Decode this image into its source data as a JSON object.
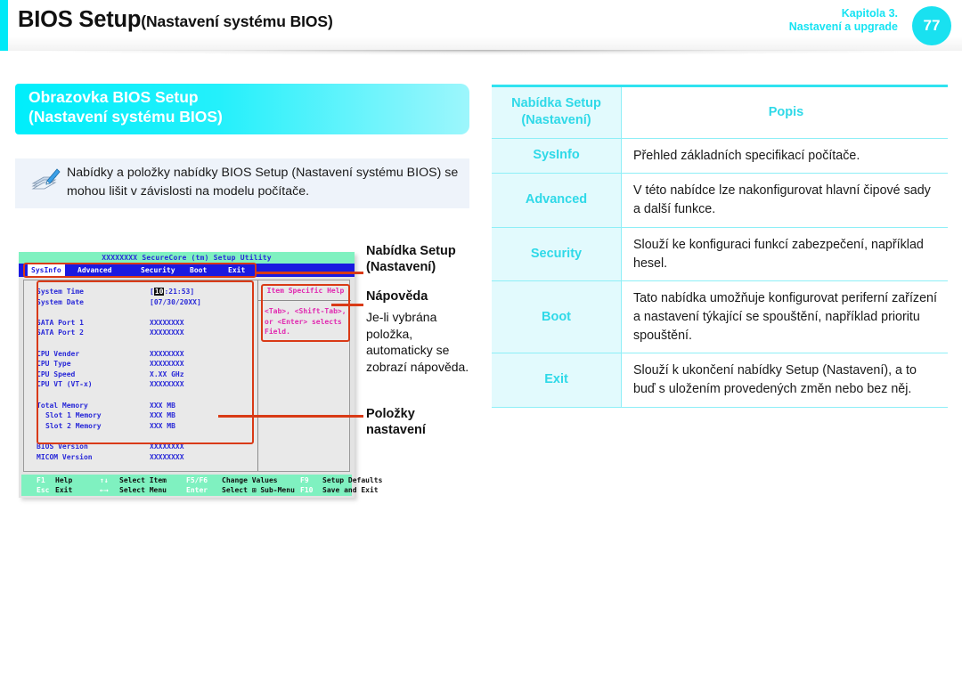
{
  "header": {
    "title_main": "BIOS Setup",
    "title_sub": "(Nastavení systému BIOS)",
    "chapter_line1": "Kapitola 3.",
    "chapter_line2": "Nastavení a upgrade",
    "page_number": "77"
  },
  "section": {
    "line1": "Obrazovka BIOS Setup",
    "line2": "(Nastavení systému BIOS)"
  },
  "note": {
    "text": "Nabídky a položky nabídky BIOS Setup (Nastavení systému BIOS) se mohou lišit v závislosti na modelu počítače."
  },
  "bios": {
    "title": "XXXXXXXX SecureCore (tm) Setup Utility",
    "menu": [
      "SysInfo",
      "Advanced",
      "Security",
      "Boot",
      "Exit"
    ],
    "active_menu": "SysInfo",
    "items": [
      {
        "key": "System Time",
        "value_pre": "[",
        "value_hl": "10",
        "value_post": ":21:53]",
        "indent": false
      },
      {
        "key": "System Date",
        "value": "[07/30/20XX]",
        "indent": false
      },
      {
        "key": "",
        "value": "",
        "spacer": true
      },
      {
        "key": "SATA Port 1",
        "value": "XXXXXXXX",
        "indent": false
      },
      {
        "key": "SATA Port 2",
        "value": "XXXXXXXX",
        "indent": false
      },
      {
        "key": "",
        "value": "",
        "spacer": true
      },
      {
        "key": "CPU Vender",
        "value": "XXXXXXXX",
        "indent": false
      },
      {
        "key": "CPU Type",
        "value": "XXXXXXXX",
        "indent": false
      },
      {
        "key": "CPU Speed",
        "value": "X.XX GHz",
        "indent": false
      },
      {
        "key": "CPU VT (VT-x)",
        "value": "XXXXXXXX",
        "indent": false
      },
      {
        "key": "",
        "value": "",
        "spacer": true
      },
      {
        "key": "Total Memory",
        "value": "XXX MB",
        "indent": false
      },
      {
        "key": "Slot 1 Memory",
        "value": "XXX MB",
        "indent": true
      },
      {
        "key": "Slot 2 Memory",
        "value": "XXX MB",
        "indent": true
      },
      {
        "key": "",
        "value": "",
        "spacer": true
      },
      {
        "key": "BIOS Version",
        "value": "XXXXXXXX",
        "indent": false
      },
      {
        "key": "MICOM Version",
        "value": "XXXXXXXX",
        "indent": false
      }
    ],
    "help_title": "Item Specific Help",
    "help_text_line1": "<Tab>, <Shift-Tab>,",
    "help_text_line2": "or <Enter> selects",
    "help_text_line3": "Field.",
    "keybar": [
      {
        "key": "F1",
        "label": "Help",
        "col": 0,
        "row": 0
      },
      {
        "key": "↑↓",
        "label": "Select Item",
        "col": 1,
        "row": 0
      },
      {
        "key": "F5/F6",
        "label": "Change Values",
        "col": 2,
        "row": 0
      },
      {
        "key": "F9",
        "label": "Setup Defaults",
        "col": 3,
        "row": 0
      },
      {
        "key": "Esc",
        "label": "Exit",
        "col": 0,
        "row": 1
      },
      {
        "key": "←→",
        "label": "Select Menu",
        "col": 1,
        "row": 1
      },
      {
        "key": "Enter",
        "label": "Select ⊞ Sub-Menu",
        "col": 2,
        "row": 1
      },
      {
        "key": "F10",
        "label": "Save and Exit",
        "col": 3,
        "row": 1
      }
    ]
  },
  "callouts": {
    "c1_line1": "Nabídka Setup",
    "c1_line2": "(Nastavení)",
    "c2_title": "Nápověda",
    "c2_body": "Je-li vybrána položka, automaticky se zobrazí nápověda.",
    "c3_line1": "Položky",
    "c3_line2": "nastavení"
  },
  "table": {
    "header": {
      "menu_line1": "Nabídka Setup",
      "menu_line2": "(Nastavení)",
      "desc": "Popis"
    },
    "rows": [
      {
        "menu": "SysInfo",
        "desc": "Přehled základních specifikací počítače."
      },
      {
        "menu": "Advanced",
        "desc": "V této nabídce lze nakonfigurovat hlavní čipové sady a další funkce."
      },
      {
        "menu": "Security",
        "desc": "Slouží ke konfiguraci funkcí zabezpečení, například hesel."
      },
      {
        "menu": "Boot",
        "desc": "Tato nabídka umožňuje konfigurovat periferní zařízení a nastavení týkající se spouštění, například prioritu spouštění."
      },
      {
        "menu": "Exit",
        "desc": "Slouží k ukončení nabídky Setup (Nastavení), a to buď s uložením provedených změn nebo bez něj."
      }
    ]
  },
  "colors": {
    "accent_cyan": "#00e9f7",
    "table_header_text": "#2fd9e8",
    "annotation_red": "#d93a16",
    "bios_blue": "#1a1ae0",
    "bios_green": "#7ff1c0",
    "bios_magenta": "#e12ab0"
  }
}
